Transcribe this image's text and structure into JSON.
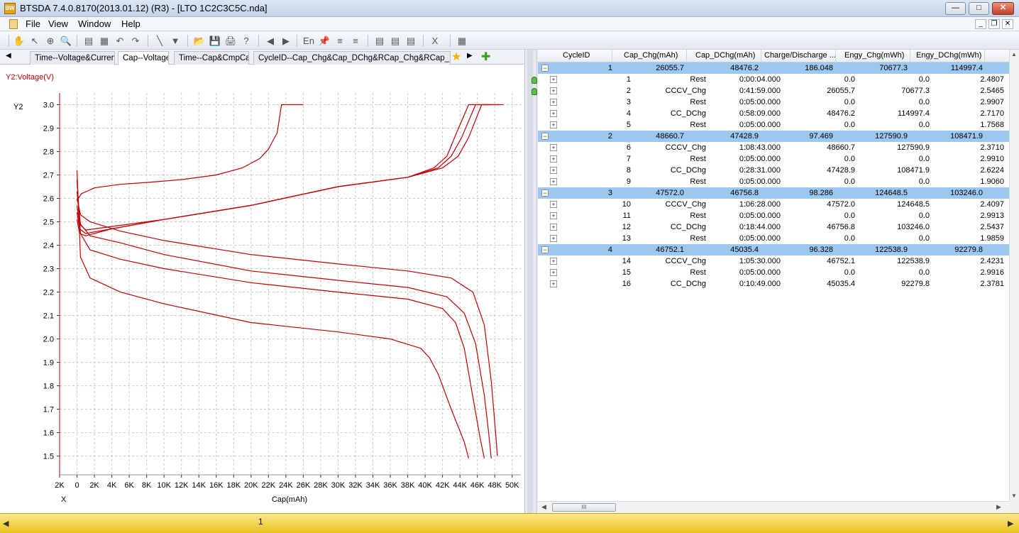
{
  "window": {
    "title": "BTSDA 7.4.0.8170(2013.01.12) (R3) - [LTO 1C2C3C5C.nda]",
    "app_icon": "app-icon",
    "controls": {
      "minimize": "—",
      "maximize": "□",
      "close": "✕"
    }
  },
  "menu": {
    "items": [
      "File",
      "View",
      "Window",
      "Help"
    ],
    "mdi": {
      "minimize": "_",
      "restore": "❐",
      "close": "✕"
    }
  },
  "toolbar": {
    "icons": [
      "hand-icon",
      "pointer-icon",
      "zoom-area-icon",
      "zoom-icon",
      "chart-icon",
      "copy-chart-icon",
      "undo-icon",
      "redo-icon",
      "line-icon",
      "filter-icon",
      "open-folder-icon",
      "save-icon",
      "print-icon",
      "help-icon",
      "back-arrow-icon",
      "forward-arrow-icon",
      "language-icon",
      "pin-icon",
      "list-a-icon",
      "list-b-icon",
      "grid-a-icon",
      "grid-b-icon",
      "grid-c-icon",
      "excel-icon",
      "layout-icon"
    ],
    "glyphs": [
      "✋",
      "↖",
      "⊕",
      "🔍",
      "▤",
      "▦",
      "↶",
      "↷",
      "╲",
      "▼",
      "📂",
      "💾",
      "🖨",
      "?",
      "◀",
      "▶",
      "En",
      "📌",
      "≡",
      "≡",
      "▤",
      "▤",
      "▤",
      "X",
      "▦"
    ]
  },
  "tabs": [
    {
      "label": "Time--Voltage&Current",
      "active": false
    },
    {
      "label": "Cap--Voltage",
      "active": true
    },
    {
      "label": "Time--Cap&CmpCap",
      "active": false
    },
    {
      "label": "CycleID--Cap_Chg&Cap_DChg&RCap_Chg&RCap_DChg",
      "active": false
    }
  ],
  "tab_nav": {
    "left": "◀",
    "right": "▶",
    "star": "★",
    "add": "✚",
    "star_icon": "star-icon",
    "add_icon": "add-tab-icon"
  },
  "chart_data": {
    "type": "line",
    "title": "",
    "series_label": "Y2:Voltage(V)",
    "ylabel": "Y2",
    "xlabel_short": "X",
    "xlabel": "Cap(mAh)",
    "xlim": [
      -2000,
      51000
    ],
    "ylim": [
      1.42,
      3.05
    ],
    "x_ticks": [
      -2000,
      0,
      2000,
      4000,
      6000,
      8000,
      10000,
      12000,
      14000,
      16000,
      18000,
      20000,
      22000,
      24000,
      26000,
      28000,
      30000,
      32000,
      34000,
      36000,
      38000,
      40000,
      42000,
      44000,
      46000,
      48000,
      50000
    ],
    "x_tick_labels": [
      "2K",
      "0",
      "2K",
      "4K",
      "6K",
      "8K",
      "10K",
      "12K",
      "14K",
      "16K",
      "18K",
      "20K",
      "22K",
      "24K",
      "26K",
      "28K",
      "30K",
      "32K",
      "34K",
      "36K",
      "38K",
      "40K",
      "42K",
      "44K",
      "46K",
      "48K",
      "50K"
    ],
    "y_ticks": [
      1.5,
      1.6,
      1.7,
      1.8,
      1.9,
      2.0,
      2.1,
      2.2,
      2.3,
      2.4,
      2.5,
      2.6,
      2.7,
      2.8,
      2.9,
      3.0
    ],
    "y_tick_labels": [
      "1.5",
      "1.6",
      "1.7",
      "1.8",
      "1.9",
      "2.0",
      "2.1",
      "2.2",
      "2.3",
      "2.4",
      "2.5",
      "2.6",
      "2.7",
      "2.8",
      "2.9",
      "3.0"
    ],
    "grid": true,
    "color": "#c00000",
    "series": [
      {
        "x": [
          0,
          500,
          2000,
          5000,
          8000,
          12000,
          16000,
          19000,
          21000,
          22000,
          23000,
          23500,
          26000
        ],
        "y": [
          2.59,
          2.62,
          2.645,
          2.66,
          2.668,
          2.68,
          2.7,
          2.73,
          2.77,
          2.81,
          2.88,
          3.0,
          3.0
        ]
      },
      {
        "x": [
          0,
          300,
          1000,
          4000,
          10000,
          20000,
          30000,
          38000,
          41000,
          42500,
          43500,
          45000,
          47500
        ],
        "y": [
          2.57,
          2.49,
          2.465,
          2.48,
          2.51,
          2.57,
          2.65,
          2.69,
          2.73,
          2.78,
          2.87,
          3.0,
          3.0
        ]
      },
      {
        "x": [
          0,
          300,
          1000,
          4000,
          10000,
          20000,
          30000,
          38000,
          41500,
          43000,
          44200,
          45800,
          48500
        ],
        "y": [
          2.54,
          2.47,
          2.45,
          2.47,
          2.51,
          2.57,
          2.65,
          2.69,
          2.73,
          2.78,
          2.86,
          3.0,
          3.0
        ]
      },
      {
        "x": [
          0,
          300,
          1000,
          4000,
          10000,
          20000,
          30000,
          38000,
          42000,
          43800,
          45000,
          46500,
          49000
        ],
        "y": [
          2.51,
          2.45,
          2.44,
          2.47,
          2.51,
          2.57,
          2.65,
          2.69,
          2.73,
          2.78,
          2.86,
          3.0,
          3.0
        ]
      },
      {
        "x": [
          0,
          400,
          1500,
          5000,
          10000,
          20000,
          30000,
          36000,
          39500,
          40500,
          41500,
          43000,
          44500,
          45000
        ],
        "y": [
          2.72,
          2.35,
          2.26,
          2.2,
          2.15,
          2.07,
          2.03,
          2.0,
          1.96,
          1.92,
          1.85,
          1.7,
          1.56,
          1.49
        ]
      },
      {
        "x": [
          0,
          400,
          1500,
          5000,
          10000,
          20000,
          30000,
          38000,
          42000,
          43500,
          44500,
          45500,
          46300,
          46800
        ],
        "y": [
          2.68,
          2.45,
          2.38,
          2.34,
          2.3,
          2.24,
          2.2,
          2.17,
          2.13,
          2.07,
          1.96,
          1.75,
          1.58,
          1.49
        ]
      },
      {
        "x": [
          0,
          400,
          1500,
          5000,
          10000,
          20000,
          30000,
          38000,
          42500,
          44500,
          45800,
          46800,
          47300,
          47600
        ],
        "y": [
          2.63,
          2.49,
          2.44,
          2.41,
          2.36,
          2.29,
          2.25,
          2.22,
          2.18,
          2.11,
          1.98,
          1.76,
          1.6,
          1.49
        ]
      },
      {
        "x": [
          0,
          400,
          1500,
          5000,
          10000,
          20000,
          30000,
          38000,
          43000,
          45500,
          46800,
          47600,
          48100,
          48300
        ],
        "y": [
          2.6,
          2.53,
          2.5,
          2.46,
          2.42,
          2.36,
          2.32,
          2.29,
          2.26,
          2.2,
          2.06,
          1.82,
          1.6,
          1.5
        ]
      }
    ]
  },
  "table": {
    "columns": [
      "CycleID",
      "Cap_Chg(mAh)",
      "Cap_DChg(mAh)",
      "Charge/Discharge ...",
      "Engy_Chg(mWh)",
      "Engy_DChg(mWh)"
    ],
    "rows": [
      {
        "kind": "cycle",
        "expander": "−",
        "cells": [
          "1",
          "26055.7",
          "48476.2",
          "186.048",
          "70677.3",
          "114997.4"
        ]
      },
      {
        "kind": "step",
        "expander": "+",
        "cells": [
          "1",
          "Rest",
          "0:00:04.000",
          "0.0",
          "0.0",
          "2.4807"
        ]
      },
      {
        "kind": "step",
        "expander": "+",
        "cells": [
          "2",
          "CCCV_Chg",
          "0:41:59.000",
          "26055.7",
          "70677.3",
          "2.5465"
        ]
      },
      {
        "kind": "step",
        "expander": "+",
        "cells": [
          "3",
          "Rest",
          "0:05:00.000",
          "0.0",
          "0.0",
          "2.9907"
        ]
      },
      {
        "kind": "step",
        "expander": "+",
        "cells": [
          "4",
          "CC_DChg",
          "0:58:09.000",
          "48476.2",
          "114997.4",
          "2.7170"
        ]
      },
      {
        "kind": "step",
        "expander": "+",
        "cells": [
          "5",
          "Rest",
          "0:05:00.000",
          "0.0",
          "0.0",
          "1.7568"
        ]
      },
      {
        "kind": "cycle",
        "expander": "−",
        "cells": [
          "2",
          "48660.7",
          "47428.9",
          "97.469",
          "127590.9",
          "108471.9"
        ]
      },
      {
        "kind": "step",
        "expander": "+",
        "cells": [
          "6",
          "CCCV_Chg",
          "1:08:43.000",
          "48660.7",
          "127590.9",
          "2.3710"
        ]
      },
      {
        "kind": "step",
        "expander": "+",
        "cells": [
          "7",
          "Rest",
          "0:05:00.000",
          "0.0",
          "0.0",
          "2.9910"
        ]
      },
      {
        "kind": "step",
        "expander": "+",
        "cells": [
          "8",
          "CC_DChg",
          "0:28:31.000",
          "47428.9",
          "108471.9",
          "2.6224"
        ]
      },
      {
        "kind": "step",
        "expander": "+",
        "cells": [
          "9",
          "Rest",
          "0:05:00.000",
          "0.0",
          "0.0",
          "1.9060"
        ]
      },
      {
        "kind": "cycle",
        "expander": "−",
        "cells": [
          "3",
          "47572.0",
          "46756.8",
          "98.286",
          "124648.5",
          "103246.0"
        ]
      },
      {
        "kind": "step",
        "expander": "+",
        "cells": [
          "10",
          "CCCV_Chg",
          "1:06:28.000",
          "47572.0",
          "124648.5",
          "2.4097"
        ]
      },
      {
        "kind": "step",
        "expander": "+",
        "cells": [
          "11",
          "Rest",
          "0:05:00.000",
          "0.0",
          "0.0",
          "2.9913"
        ]
      },
      {
        "kind": "step",
        "expander": "+",
        "cells": [
          "12",
          "CC_DChg",
          "0:18:44.000",
          "46756.8",
          "103246.0",
          "2.5437"
        ]
      },
      {
        "kind": "step",
        "expander": "+",
        "cells": [
          "13",
          "Rest",
          "0:05:00.000",
          "0.0",
          "0.0",
          "1.9859"
        ]
      },
      {
        "kind": "cycle",
        "expander": "−",
        "cells": [
          "4",
          "46752.1",
          "45035.4",
          "96.328",
          "122538.9",
          "92279.8"
        ]
      },
      {
        "kind": "step",
        "expander": "+",
        "cells": [
          "14",
          "CCCV_Chg",
          "1:05:30.000",
          "46752.1",
          "122538.9",
          "2.4231"
        ]
      },
      {
        "kind": "step",
        "expander": "+",
        "cells": [
          "15",
          "Rest",
          "0:05:00.000",
          "0.0",
          "0.0",
          "2.9916"
        ]
      },
      {
        "kind": "step",
        "expander": "+",
        "cells": [
          "16",
          "CC_DChg",
          "0:10:49.000",
          "45035.4",
          "92279.8",
          "2.3781"
        ]
      }
    ]
  },
  "scroll": {
    "up": "▲",
    "down": "▼",
    "left": "◀",
    "right": "▶",
    "thumb": "III"
  },
  "bottom_bar": {
    "value": "1",
    "left": "◀",
    "right": "▶"
  },
  "colors": {
    "accent": "#9cc7ef",
    "curve": "#c00000",
    "bottom_bar": "#f2d43a"
  }
}
